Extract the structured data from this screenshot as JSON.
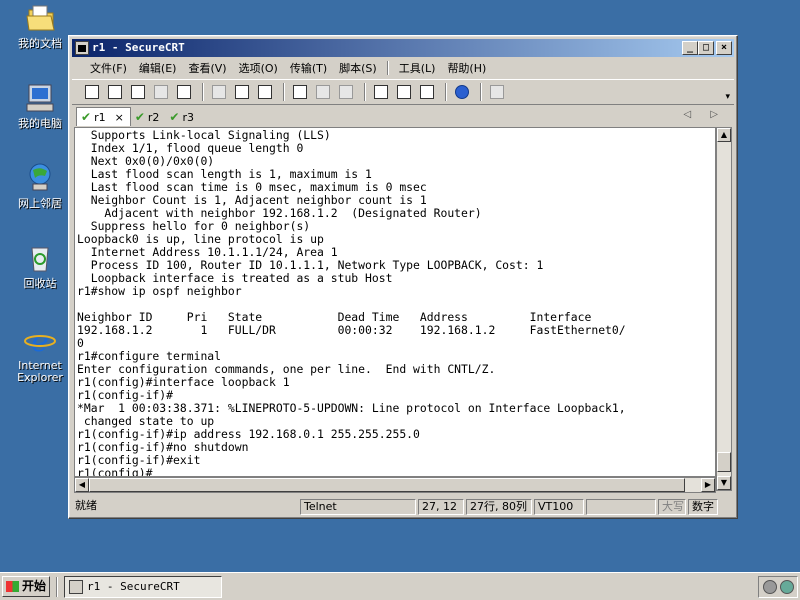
{
  "desktop": {
    "icons": [
      {
        "label": "我的文档",
        "icon": "my-documents-icon"
      },
      {
        "label": "我的电脑",
        "icon": "my-computer-icon"
      },
      {
        "label": "网上邻居",
        "icon": "network-places-icon"
      },
      {
        "label": "回收站",
        "icon": "recycle-bin-icon"
      },
      {
        "label": "Internet Explorer",
        "icon": "internet-explorer-icon"
      }
    ]
  },
  "window": {
    "title": "r1 - SecureCRT",
    "controls": {
      "minimize": "_",
      "maximize": "□",
      "close": "×"
    }
  },
  "menu": [
    "文件(F)",
    "编辑(E)",
    "查看(V)",
    "选项(O)",
    "传输(T)",
    "脚本(S)",
    "工具(L)",
    "帮助(H)"
  ],
  "toolbar": {
    "icons": [
      "connect-icon",
      "quick-connect-icon",
      "connect-tab-icon",
      "reconnect-icon",
      "disconnect-icon",
      "copy-icon",
      "paste-icon",
      "find-icon",
      "print-icon",
      "print-selection-icon",
      "print-setup-icon",
      "session-options-icon",
      "global-options-icon",
      "keymap-icon",
      "help-icon",
      "sftp-icon"
    ],
    "grip": "▾"
  },
  "tabs": [
    {
      "label": "r1",
      "active": true,
      "close": "×"
    },
    {
      "label": "r2",
      "active": false
    },
    {
      "label": "r3",
      "active": false
    }
  ],
  "tab_arrows": "◁ ▷",
  "terminal": {
    "lines": [
      "  Supports Link-local Signaling (LLS)",
      "  Index 1/1, flood queue length 0",
      "  Next 0x0(0)/0x0(0)",
      "  Last flood scan length is 1, maximum is 1",
      "  Last flood scan time is 0 msec, maximum is 0 msec",
      "  Neighbor Count is 1, Adjacent neighbor count is 1",
      "    Adjacent with neighbor 192.168.1.2  (Designated Router)",
      "  Suppress hello for 0 neighbor(s)",
      "Loopback0 is up, line protocol is up",
      "  Internet Address 10.1.1.1/24, Area 1",
      "  Process ID 100, Router ID 10.1.1.1, Network Type LOOPBACK, Cost: 1",
      "  Loopback interface is treated as a stub Host",
      "r1#show ip ospf neighbor",
      "",
      "Neighbor ID     Pri   State           Dead Time   Address         Interface",
      "192.168.1.2       1   FULL/DR         00:00:32    192.168.1.2     FastEthernet0/",
      "0",
      "r1#configure terminal",
      "Enter configuration commands, one per line.  End with CNTL/Z.",
      "r1(config)#interface loopback 1",
      "r1(config-if)#",
      "*Mar  1 00:03:38.371: %LINEPROTO-5-UPDOWN: Line protocol on Interface Loopback1,",
      " changed state to up",
      "r1(config-if)#ip address 192.168.0.1 255.255.255.0",
      "r1(config-if)#no shutdown",
      "r1(config-if)#exit",
      "r1(config)#"
    ]
  },
  "scroll": {
    "up": "▲",
    "down": "▼",
    "left": "◀",
    "right": "▶"
  },
  "status": {
    "ready": "就绪",
    "protocol": "Telnet",
    "cursor": "27, 12",
    "size": "27行, 80列",
    "emulation": "VT100",
    "blank": "",
    "caps": "大写",
    "num": "数字"
  },
  "taskbar": {
    "start": "开始",
    "task": "r1 - SecureCRT"
  }
}
